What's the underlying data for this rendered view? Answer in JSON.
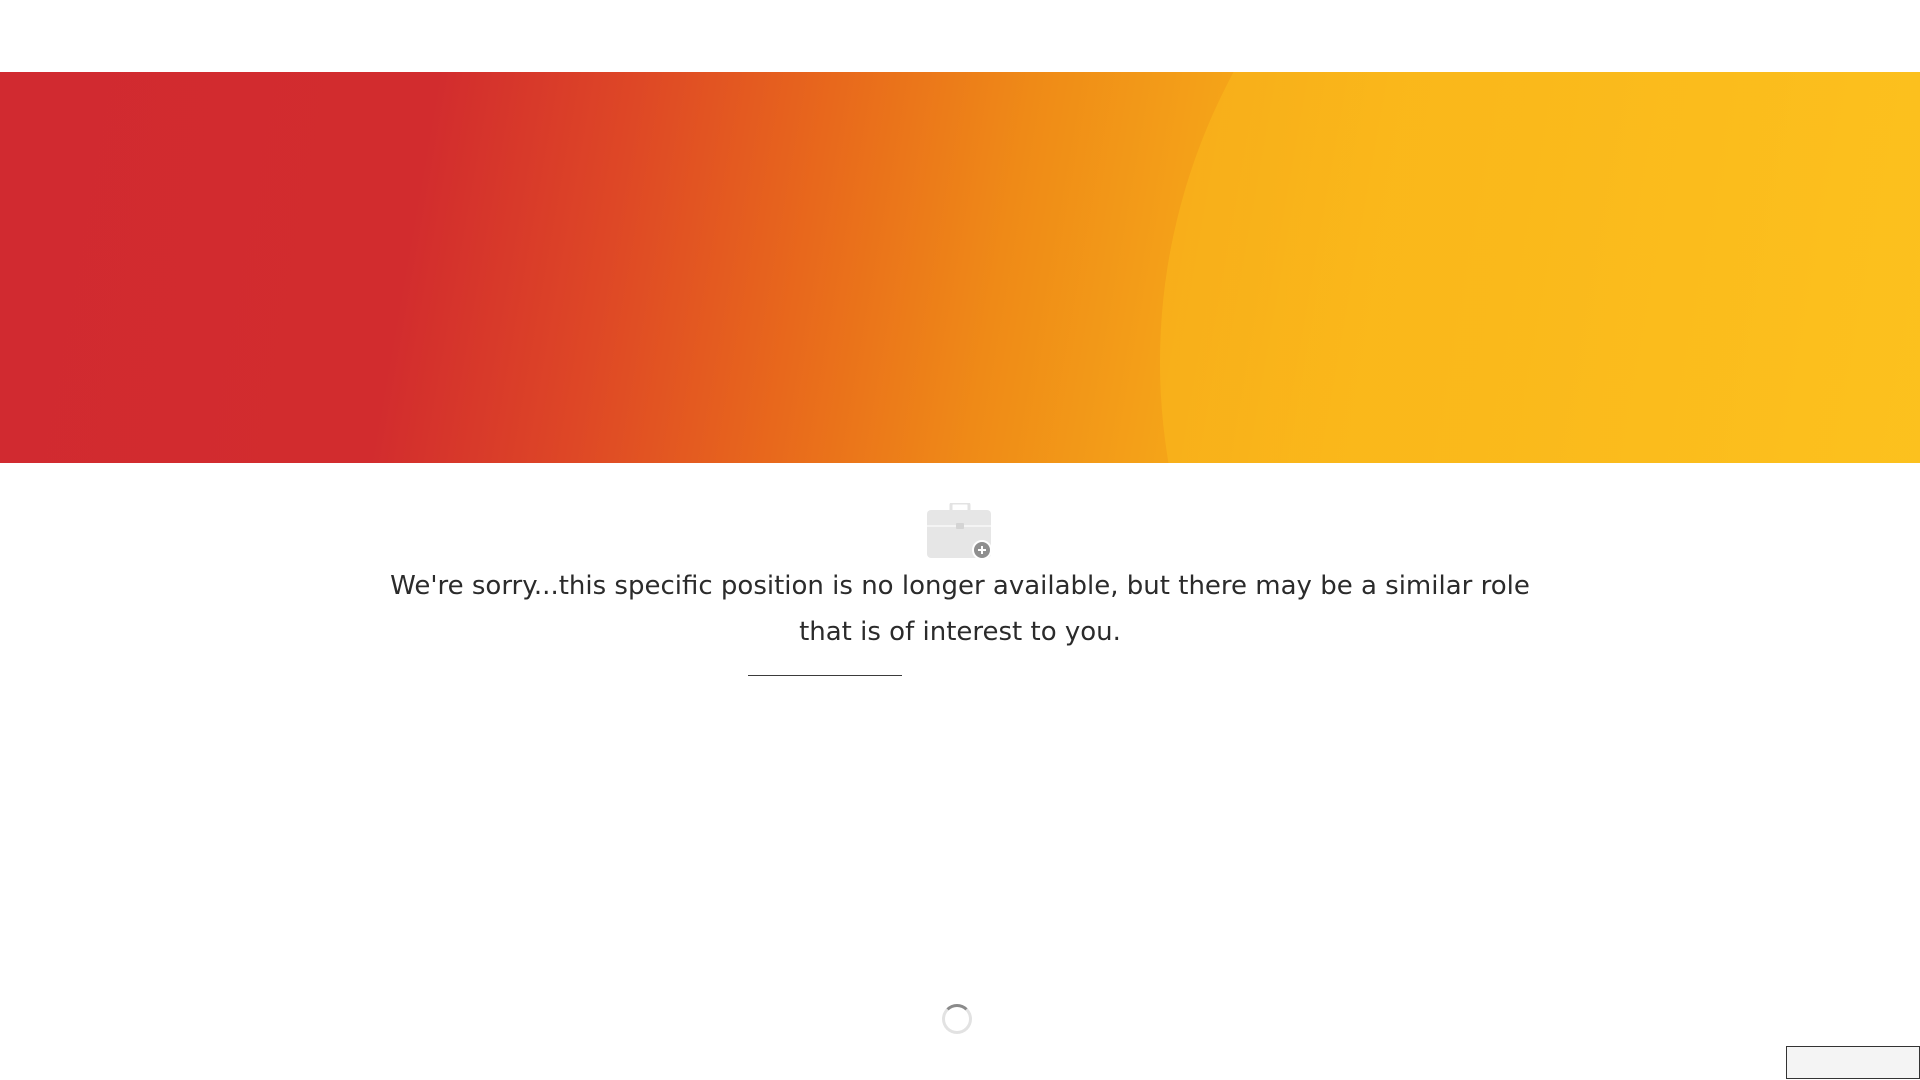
{
  "hero": {
    "colors": [
      "#d12a30",
      "#e8681c",
      "#f5a418",
      "#fcc21e"
    ]
  },
  "job_status": {
    "icon": "briefcase-plus-icon",
    "message": "We're sorry...this specific position is no longer available, but there may be a similar role that is of interest to you."
  },
  "loading": {
    "icon": "loading-spinner-icon"
  }
}
